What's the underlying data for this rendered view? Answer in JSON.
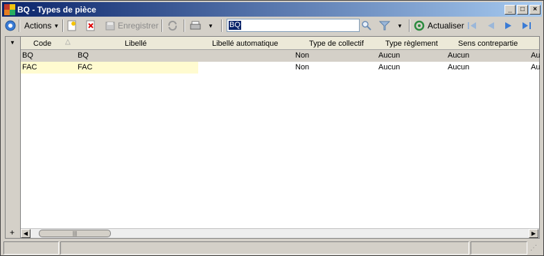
{
  "window": {
    "title": "BQ -  Types de pièce",
    "minimize": "_",
    "maximize": "□",
    "close": "×"
  },
  "toolbar": {
    "actions_label": "Actions",
    "save_label": "Enregistrer",
    "refresh_label": "Actualiser",
    "search_value": "BQ"
  },
  "grid": {
    "columns": [
      "Code",
      "Libellé",
      "Libellé automatique",
      "Type de collectif",
      "Type règlement",
      "Sens contrepartie"
    ],
    "rows": [
      {
        "code": "BQ",
        "libelle": "BQ",
        "libelle_auto": "",
        "collectif": "Non",
        "reglement": "Aucun",
        "sens": "Aucun",
        "extra": "Au"
      },
      {
        "code": "FAC",
        "libelle": "FAC",
        "libelle_auto": "",
        "collectif": "Non",
        "reglement": "Aucun",
        "sens": "Aucun",
        "extra": "Au"
      }
    ],
    "add_symbol": "+"
  },
  "colors": {
    "title_start": "#0a246a",
    "title_end": "#a6caf0",
    "row_highlight": "#fffbd0"
  }
}
